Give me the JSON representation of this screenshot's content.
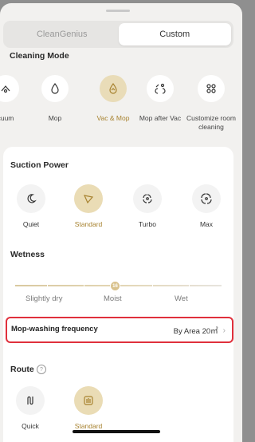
{
  "tabs": [
    {
      "label": "CleanGenius",
      "active": false
    },
    {
      "label": "Custom",
      "active": true
    }
  ],
  "cleaning_mode": {
    "title": "Cleaning Mode",
    "items": [
      {
        "label": "cuum",
        "icon": "vacuum-icon",
        "selected": false
      },
      {
        "label": "Mop",
        "icon": "mop-drop-icon",
        "selected": false
      },
      {
        "label": "Vac & Mop",
        "icon": "vac-mop-icon",
        "selected": true
      },
      {
        "label": "Mop after Vac",
        "icon": "mop-after-vac-icon",
        "selected": false
      },
      {
        "label": "Customize room cleaning",
        "icon": "customize-rooms-icon",
        "selected": false
      }
    ]
  },
  "suction": {
    "title": "Suction Power",
    "items": [
      {
        "label": "Quiet",
        "icon": "quiet-icon",
        "selected": false
      },
      {
        "label": "Standard",
        "icon": "standard-icon",
        "selected": true
      },
      {
        "label": "Turbo",
        "icon": "turbo-fan-icon",
        "selected": false
      },
      {
        "label": "Max",
        "icon": "max-fan-icon",
        "selected": false
      }
    ]
  },
  "wetness": {
    "title": "Wetness",
    "value": "16",
    "labels": [
      "Slightly dry",
      "Moist",
      "Wet"
    ]
  },
  "mop_washing": {
    "label": "Mop-washing frequency",
    "value": "By Area 20㎡"
  },
  "route": {
    "title": "Route",
    "help": "?",
    "items": [
      {
        "label": "Quick",
        "icon": "quick-route-icon",
        "selected": false
      },
      {
        "label": "Standard",
        "icon": "standard-route-icon",
        "selected": true
      }
    ]
  },
  "colors": {
    "accent": "#a7822f",
    "selected_bg": "#e9dcb8",
    "highlight_border": "#e0303c"
  }
}
